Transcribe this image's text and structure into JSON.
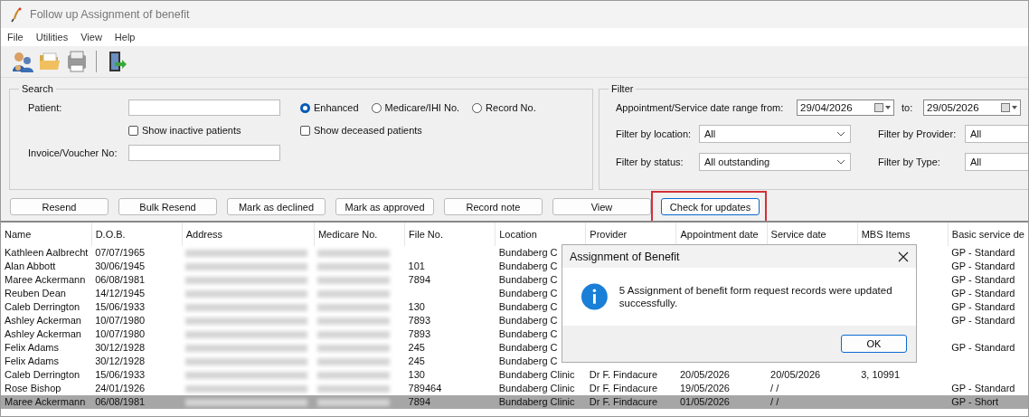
{
  "window": {
    "title": "Follow up Assignment of benefit"
  },
  "menu": [
    "File",
    "Utilities",
    "View",
    "Help"
  ],
  "toolbar": [
    {
      "kind": "people"
    },
    {
      "kind": "folder"
    },
    {
      "kind": "printer"
    },
    {
      "kind": "separator"
    },
    {
      "kind": "exit"
    }
  ],
  "search": {
    "title": "Search",
    "patient_label": "Patient:",
    "invoice_label": "Invoice/Voucher No:",
    "modes": [
      {
        "label": "Enhanced",
        "selected": true
      },
      {
        "label": "Medicare/IHI No.",
        "selected": false
      },
      {
        "label": "Record No.",
        "selected": false
      }
    ],
    "options": [
      {
        "label": "Show inactive patients",
        "checked": false
      },
      {
        "label": "Show deceased patients",
        "checked": false
      }
    ]
  },
  "filter": {
    "title": "Filter",
    "date_label": "Appointment/Service date range from:",
    "from": "29/04/2026",
    "to_label": "to:",
    "to": "29/05/2026",
    "selects": [
      {
        "label": "Filter by location:",
        "value": "All"
      },
      {
        "label": "Filter by Provider:",
        "value": "All"
      },
      {
        "label": "Filter by status:",
        "value": "All outstanding"
      },
      {
        "label": "Filter by Type:",
        "value": "All"
      }
    ]
  },
  "actions": [
    {
      "label": "Resend",
      "highlighted": false
    },
    {
      "label": "Bulk Resend",
      "highlighted": false
    },
    {
      "label": "Mark as declined",
      "highlighted": false
    },
    {
      "label": "Mark as approved",
      "highlighted": false
    },
    {
      "label": "Record note",
      "highlighted": false
    },
    {
      "label": "View",
      "highlighted": false
    },
    {
      "label": "Check for updates",
      "highlighted": true
    }
  ],
  "table": {
    "columns": [
      "Name",
      "D.O.B.",
      "Address",
      "Medicare No.",
      "File No.",
      "Location",
      "Provider",
      "Appointment date",
      "Service date",
      "MBS Items",
      "Basic service de"
    ],
    "rows": [
      {
        "name": "Kathleen Aalbrecht",
        "dob": "07/07/1965",
        "location": "Bundaberg C",
        "basic": "GP - Standard",
        "selected": false
      },
      {
        "name": "Alan Abbott",
        "dob": "30/06/1945",
        "file": "101",
        "location": "Bundaberg C",
        "basic": "GP - Standard",
        "selected": false
      },
      {
        "name": "Maree Ackermann",
        "dob": "06/08/1981",
        "file": "7894",
        "location": "Bundaberg C",
        "basic": "GP - Standard",
        "selected": false
      },
      {
        "name": "Reuben Dean",
        "dob": "14/12/1945",
        "location": "Bundaberg C",
        "basic": "GP - Standard",
        "selected": false
      },
      {
        "name": "Caleb Derrington",
        "dob": "15/06/1933",
        "file": "130",
        "location": "Bundaberg C",
        "basic": "GP - Standard",
        "selected": false
      },
      {
        "name": "Ashley Ackerman",
        "dob": "10/07/1980",
        "file": "7893",
        "location": "Bundaberg C",
        "basic": "GP - Standard",
        "selected": false
      },
      {
        "name": "Ashley Ackerman",
        "dob": "10/07/1980",
        "file": "7893",
        "location": "Bundaberg C",
        "selected": false
      },
      {
        "name": "Felix Adams",
        "dob": "30/12/1928",
        "file": "245",
        "location": "Bundaberg C",
        "basic": "GP - Standard",
        "selected": false
      },
      {
        "name": "Felix Adams",
        "dob": "30/12/1928",
        "file": "245",
        "location": "Bundaberg C",
        "selected": false
      },
      {
        "name": "Caleb Derrington",
        "dob": "15/06/1933",
        "file": "130",
        "location": "Bundaberg Clinic",
        "provider": "Dr F. Findacure",
        "appointment": "20/05/2026",
        "service": "20/05/2026",
        "mbs": "3, 10991",
        "selected": false
      },
      {
        "name": "Rose Bishop",
        "dob": "24/01/1926",
        "file": "789464",
        "location": "Bundaberg Clinic",
        "provider": "Dr F. Findacure",
        "appointment": "19/05/2026",
        "service": " /  /",
        "basic": "GP - Standard",
        "selected": false
      },
      {
        "name": "Maree Ackermann",
        "dob": "06/08/1981",
        "file": "7894",
        "location": "Bundaberg Clinic",
        "provider": "Dr F. Findacure",
        "appointment": "01/05/2026",
        "service": " /  /",
        "basic": "GP - Short",
        "selected": true
      }
    ]
  },
  "dialog": {
    "title": "Assignment of Benefit",
    "message": "5 Assignment of benefit form request records were updated successfully.",
    "button": "OK"
  }
}
